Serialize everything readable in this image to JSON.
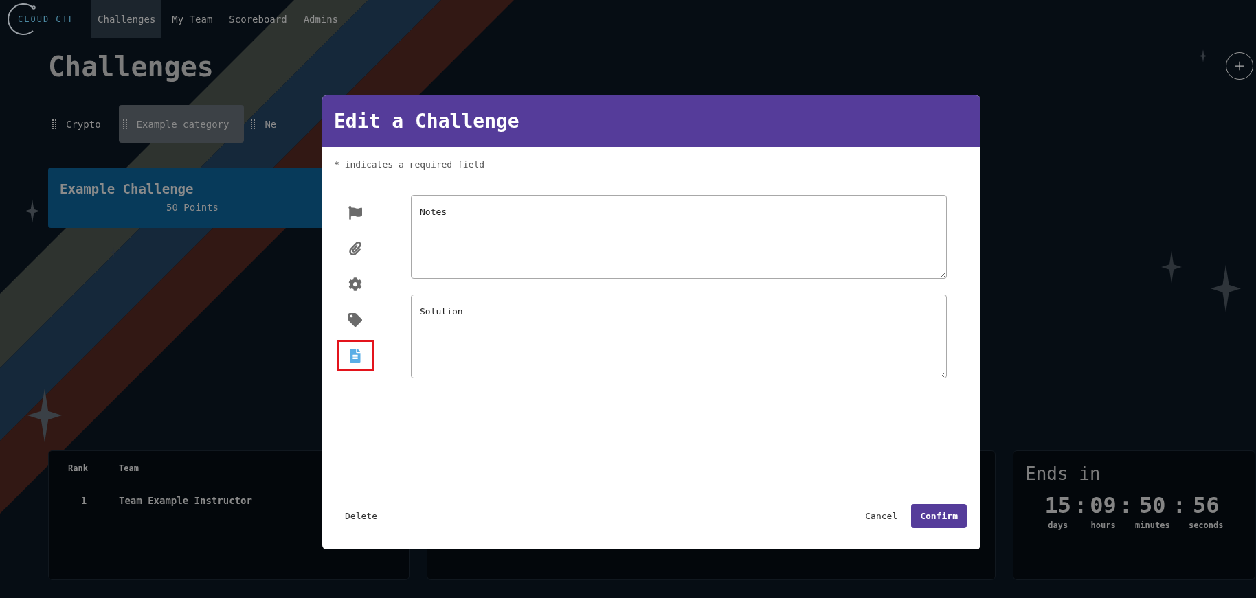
{
  "nav": {
    "logo_text": "CLOUD CTF",
    "items": [
      {
        "label": "Challenges",
        "selected": true
      },
      {
        "label": "My Team",
        "selected": false
      },
      {
        "label": "Scoreboard",
        "selected": false
      },
      {
        "label": "Admins",
        "selected": false
      }
    ]
  },
  "page_title": "Challenges",
  "categories": [
    {
      "label": "Crypto",
      "selected": false
    },
    {
      "label": "Example category",
      "selected": true
    },
    {
      "label": "Ne",
      "selected": false
    }
  ],
  "challenges": [
    {
      "name": "Example Challenge",
      "points": "50 Points"
    }
  ],
  "scoreboard": {
    "columns": [
      "Rank",
      "Team"
    ],
    "rows": [
      [
        "1",
        "Team Example Instructor"
      ]
    ]
  },
  "countdown": {
    "title": "Ends in",
    "separator": ":",
    "units": [
      {
        "value": "15",
        "label": "days"
      },
      {
        "value": "09",
        "label": "hours"
      },
      {
        "value": "50",
        "label": "minutes"
      },
      {
        "value": "56",
        "label": "seconds"
      }
    ]
  },
  "modal": {
    "title": "Edit a Challenge",
    "note": "* indicates a required field",
    "tabs": [
      {
        "kind": "flag",
        "selected": false
      },
      {
        "kind": "attachment",
        "selected": false
      },
      {
        "kind": "settings",
        "selected": false
      },
      {
        "kind": "tag",
        "selected": false
      },
      {
        "kind": "document",
        "selected": true
      }
    ],
    "fields": [
      {
        "placeholder": "Notes"
      },
      {
        "placeholder": "Solution"
      }
    ],
    "delete": "Delete",
    "cancel": "Cancel",
    "confirm": "Confirm"
  }
}
